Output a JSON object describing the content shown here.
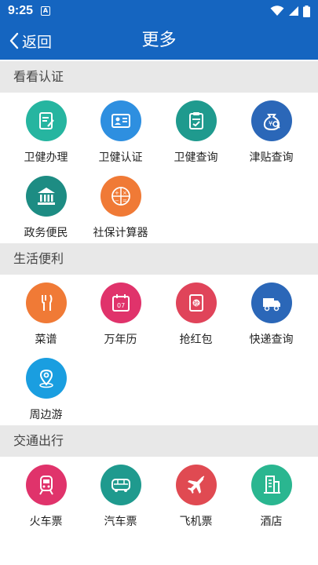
{
  "status": {
    "time": "9:25",
    "notification": "A"
  },
  "header": {
    "back_label": "返回",
    "title": "更多"
  },
  "sections": [
    {
      "title": "看看认证",
      "items": [
        {
          "label": "卫健办理",
          "icon": "edit-note-icon",
          "color": "#26b5a0"
        },
        {
          "label": "卫健认证",
          "icon": "id-card-icon",
          "color": "#2e8fe0"
        },
        {
          "label": "卫健查询",
          "icon": "clipboard-check-icon",
          "color": "#1f9a8e"
        },
        {
          "label": "津贴查询",
          "icon": "money-bag-search-icon",
          "color": "#2b67b8"
        },
        {
          "label": "政务便民",
          "icon": "government-building-icon",
          "color": "#1d8c83"
        },
        {
          "label": "社保计算器",
          "icon": "calculator-icon",
          "color": "#f07a36"
        }
      ]
    },
    {
      "title": "生活便利",
      "items": [
        {
          "label": "菜谱",
          "icon": "cutlery-icon",
          "color": "#f07a36"
        },
        {
          "label": "万年历",
          "icon": "calendar-icon",
          "color": "#e0336b"
        },
        {
          "label": "抢红包",
          "icon": "red-packet-icon",
          "color": "#e0445a"
        },
        {
          "label": "快递查询",
          "icon": "delivery-truck-icon",
          "color": "#2b67b8"
        },
        {
          "label": "周边游",
          "icon": "location-pin-icon",
          "color": "#1a9ee0"
        }
      ]
    },
    {
      "title": "交通出行",
      "items": [
        {
          "label": "火车票",
          "icon": "train-icon",
          "color": "#e0336b"
        },
        {
          "label": "汽车票",
          "icon": "bus-icon",
          "color": "#1f9a8e"
        },
        {
          "label": "飞机票",
          "icon": "airplane-icon",
          "color": "#e04a52"
        },
        {
          "label": "酒店",
          "icon": "hotel-building-icon",
          "color": "#2ab690"
        }
      ]
    }
  ],
  "calendar_day": "07",
  "red_packet_char": "抢"
}
